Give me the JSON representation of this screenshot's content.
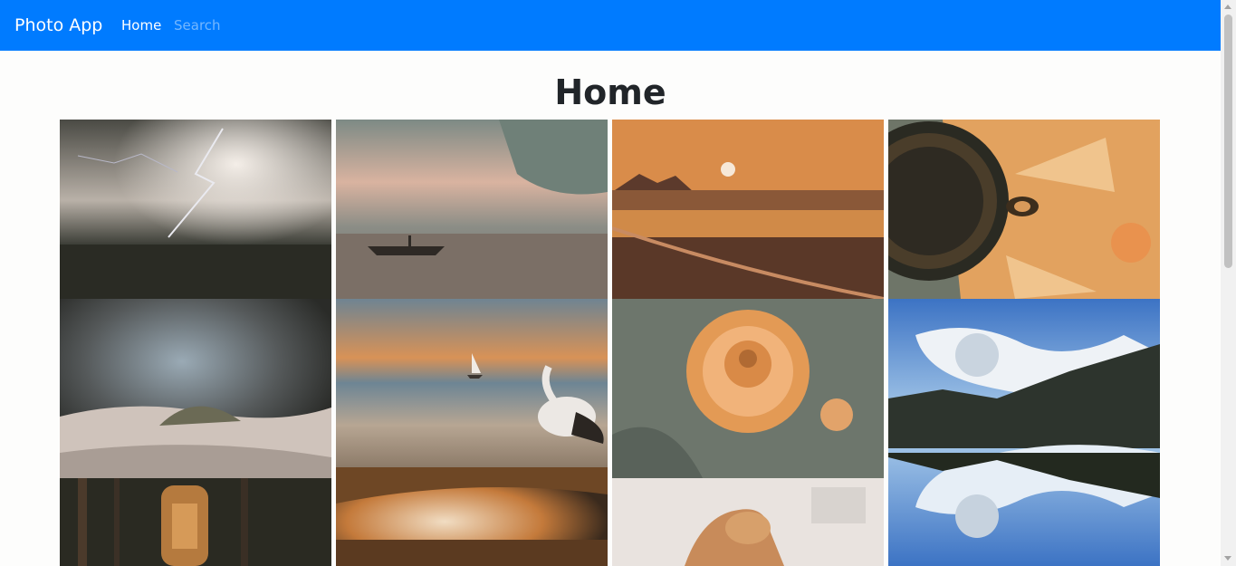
{
  "navbar": {
    "brand": "Photo App",
    "home_label": "Home",
    "search_placeholder": "Search",
    "color": "#007bff"
  },
  "page": {
    "title": "Home"
  },
  "photos": [
    {
      "id": "photo-lightning-storm"
    },
    {
      "id": "photo-boat-sunset"
    },
    {
      "id": "photo-orange-field-sunset"
    },
    {
      "id": "photo-sunflower-bee"
    },
    {
      "id": "photo-beach-dunes"
    },
    {
      "id": "photo-pelican-sailboat"
    },
    {
      "id": "photo-dahlia-flower"
    },
    {
      "id": "photo-mountain-lake"
    },
    {
      "id": "photo-lantern-dark"
    },
    {
      "id": "photo-autumn-tree"
    },
    {
      "id": "photo-squirrel"
    }
  ]
}
